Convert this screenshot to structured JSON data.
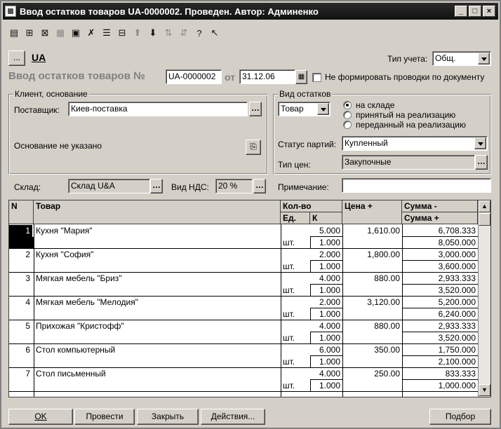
{
  "window": {
    "title": "Ввод остатков товаров UA-0000002. Проведен. Автор: Админенко"
  },
  "org": {
    "button": "...",
    "name": "UA"
  },
  "tip_ucheta": {
    "label": "Тип учета:",
    "value": "Общ."
  },
  "doc": {
    "heading": "Ввод остатков товаров №",
    "number": "UA-0000002",
    "from_label": "от",
    "date": "31.12.06",
    "no_posting_label": "Не формировать проводки по документу"
  },
  "client_group": {
    "title": "Клиент, основание",
    "supplier_label": "Поставщик:",
    "supplier": "Киев-поставка",
    "basis_text": "Основание не указано"
  },
  "vid_group": {
    "title": "Вид остатков",
    "type_value": "Товар",
    "radios": [
      "на складе",
      "принятый на реализацию",
      "переданный на реализацию"
    ],
    "status_label": "Статус партий:",
    "status_value": "Купленный",
    "price_type_label": "Тип цен:",
    "price_type_value": "Закупочные"
  },
  "sklad": {
    "label": "Склад:",
    "value": "Склад U&A"
  },
  "nds": {
    "label": "Вид НДС:",
    "value": "20 %"
  },
  "note": {
    "label": "Примечание:",
    "value": ""
  },
  "grid": {
    "headers": {
      "n": "N",
      "tovar": "Товар",
      "kolvo": "Кол-во",
      "ed": "Ед.",
      "k": "К",
      "price": "Цена +",
      "sum1": "Сумма -",
      "sum2": "Сумма +"
    },
    "rows": [
      {
        "n": "1",
        "name": "Кухня \"Мария\"",
        "unit": "шт.",
        "qty": "5.000",
        "k": "1.000",
        "price": "1,610.00",
        "sum1": "6,708.333",
        "sum2": "8,050.000"
      },
      {
        "n": "2",
        "name": "Кухня \"София\"",
        "unit": "шт.",
        "qty": "2.000",
        "k": "1.000",
        "price": "1,800.00",
        "sum1": "3,000.000",
        "sum2": "3,600.000"
      },
      {
        "n": "3",
        "name": "Мягкая мебель \"Бриз\"",
        "unit": "шт.",
        "qty": "4.000",
        "k": "1.000",
        "price": "880.00",
        "sum1": "2,933.333",
        "sum2": "3,520.000"
      },
      {
        "n": "4",
        "name": "Мягкая мебель \"Мелодия\"",
        "unit": "шт.",
        "qty": "2.000",
        "k": "1.000",
        "price": "3,120.00",
        "sum1": "5,200.000",
        "sum2": "6,240.000"
      },
      {
        "n": "5",
        "name": "Прихожая \"Кристофф\"",
        "unit": "шт.",
        "qty": "4.000",
        "k": "1.000",
        "price": "880.00",
        "sum1": "2,933.333",
        "sum2": "3,520.000"
      },
      {
        "n": "6",
        "name": "Стол компьютерный",
        "unit": "шт.",
        "qty": "6.000",
        "k": "1.000",
        "price": "350.00",
        "sum1": "1,750.000",
        "sum2": "2,100.000"
      },
      {
        "n": "7",
        "name": "Стол письменный",
        "unit": "шт.",
        "qty": "4.000",
        "k": "1.000",
        "price": "250.00",
        "sum1": "833.333",
        "sum2": "1,000.000"
      }
    ]
  },
  "buttons": {
    "ok": "OK",
    "post": "Провести",
    "close": "Закрыть",
    "actions": "Действия...",
    "selection": "Подбор"
  },
  "toolbar_icons": [
    "add-row-icon",
    "copy-row-icon",
    "delete-row-icon",
    "edit-row-icon",
    "group-icon",
    "delete-mark-icon",
    "properties-icon",
    "subtable-icon",
    "move-up-icon",
    "move-down-icon",
    "sort-asc-icon",
    "sort-desc-icon",
    "help-icon",
    "whats-this-icon"
  ]
}
